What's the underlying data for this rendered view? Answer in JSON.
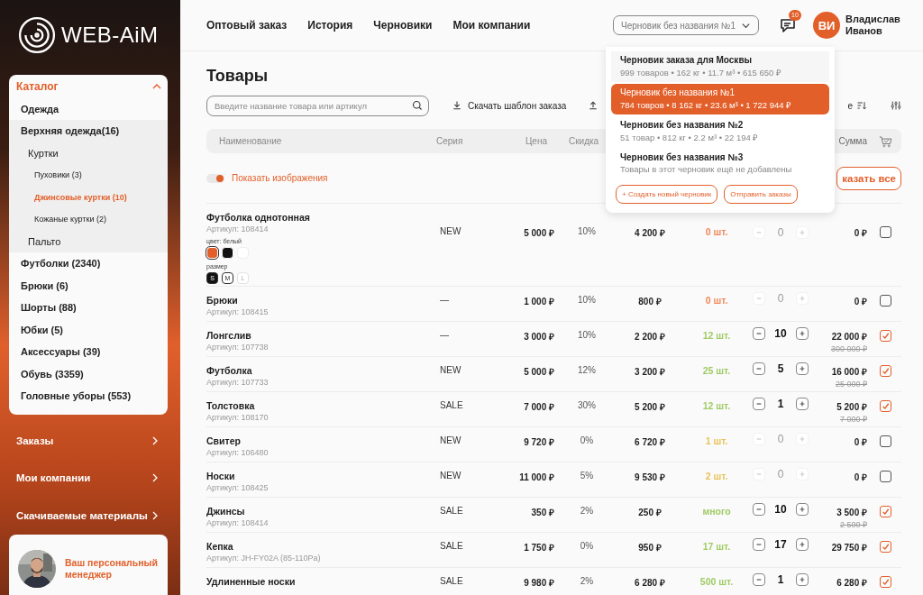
{
  "brand": {
    "name": "WEB-AiM"
  },
  "catalog": {
    "title": "Каталог",
    "expanded": true,
    "items": [
      {
        "label": "Одежда",
        "selected": false
      },
      {
        "label": "Верхняя одежда(16)",
        "selected": false,
        "expanded": true,
        "children": [
          {
            "label": "Куртки",
            "selected": false,
            "expanded": true,
            "children": [
              {
                "label": "Пуховики (3)",
                "selected": false
              },
              {
                "label": "Джинсовые куртки (10)",
                "selected": true
              },
              {
                "label": "Кожаные куртки (2)",
                "selected": false
              }
            ]
          },
          {
            "label": "Пальто",
            "selected": false
          }
        ]
      },
      {
        "label": "Футболки (2340)",
        "selected": false
      },
      {
        "label": "Брюки (6)",
        "selected": false
      },
      {
        "label": "Шорты (88)",
        "selected": false
      },
      {
        "label": "Юбки (5)",
        "selected": false
      },
      {
        "label": "Аксессуары (39)",
        "selected": false
      },
      {
        "label": "Обувь (3359)",
        "selected": false
      },
      {
        "label": "Головные уборы (553)",
        "selected": false
      }
    ]
  },
  "sidebar_nav": [
    "Заказы",
    "Мои компании",
    "Скачиваемые материалы"
  ],
  "manager": {
    "label": "Ваш персональный менеджер"
  },
  "top_nav": [
    "Оптовый заказ",
    "История",
    "Черновики",
    "Мои компании"
  ],
  "draft_select": {
    "value": "Черновик без названия №1"
  },
  "chat": {
    "badge": "10"
  },
  "user": {
    "initials": "ВИ",
    "name": "Владислав Иванов"
  },
  "page_title": "Товары",
  "search": {
    "placeholder": "Введите название товара или артикул"
  },
  "download_link": "Скачать шаблон заказа",
  "sort_label": "е",
  "table": {
    "columns": [
      "Наименование",
      "Серия",
      "Цена",
      "Скидка",
      "Сумма"
    ],
    "show_images": {
      "label": "Показать изображения",
      "on": true
    },
    "order_all_button": "казать все",
    "rows": [
      {
        "name": "Футболка однотонная",
        "article": "Артикул: 108414",
        "series": "NEW",
        "price": "5 000 ₽",
        "discount": "10%",
        "discounted": "4 200 ₽",
        "stock": "0 шт.",
        "color": "#f0885a",
        "qty": "0",
        "sum": "0 ₽",
        "checked": false,
        "variants": {
          "color_label": "цвет: белый",
          "colors": [
            {
              "color": "#e35f2a",
              "selected": true
            },
            {
              "color": "#111111",
              "selected": false
            },
            {
              "color": "#ffffff",
              "selected": false
            }
          ],
          "size_label": "размер",
          "sizes": [
            {
              "label": "S",
              "selected": true,
              "disabled": false
            },
            {
              "label": "M",
              "selected": false,
              "disabled": false
            },
            {
              "label": "L",
              "selected": false,
              "disabled": true
            }
          ]
        }
      },
      {
        "name": "Брюки",
        "article": "Артикул: 108415",
        "series": "—",
        "price": "1 000 ₽",
        "discount": "10%",
        "discounted": "800 ₽",
        "stock": "0 шт.",
        "color": "#f0885a",
        "qty": "0",
        "sum": "0 ₽",
        "checked": false
      },
      {
        "name": "Лонгслив",
        "article": "Артикул: 107738",
        "series": "—",
        "price": "3 000 ₽",
        "discount": "10%",
        "discounted": "2 200 ₽",
        "stock": "12 шт.",
        "color": "#9fcb63",
        "qty": "10",
        "sum": "22 000 ₽",
        "old_sum": "300 000 ₽",
        "checked": true
      },
      {
        "name": "Футболка",
        "article": "Артикул: 107733",
        "series": "NEW",
        "price": "5 000 ₽",
        "discount": "12%",
        "discounted": "3 200 ₽",
        "stock": "25 шт.",
        "color": "#9fcb63",
        "qty": "5",
        "sum": "16 000 ₽",
        "old_sum": "25 000 ₽",
        "checked": true
      },
      {
        "name": "Толстовка",
        "article": "Артикул: 108170",
        "series": "SALE",
        "price": "7 000 ₽",
        "discount": "30%",
        "discounted": "5 200 ₽",
        "stock": "12 шт.",
        "color": "#9fcb63",
        "qty": "1",
        "sum": "5 200 ₽",
        "old_sum": "7 000 ₽",
        "checked": true
      },
      {
        "name": "Свитер",
        "article": "Артикул: 106480",
        "series": "NEW",
        "price": "9 720 ₽",
        "discount": "0%",
        "discounted": "6 720 ₽",
        "stock": "1 шт.",
        "color": "#e8c35a",
        "qty": "0",
        "sum": "0 ₽",
        "checked": false
      },
      {
        "name": "Носки",
        "article": "Артикул: 108425",
        "series": "NEW",
        "price": "11 000 ₽",
        "discount": "5%",
        "discounted": "9 530 ₽",
        "stock": "2 шт.",
        "color": "#e8c35a",
        "qty": "0",
        "sum": "0 ₽",
        "checked": false
      },
      {
        "name": "Джинсы",
        "article": "Артикул: 108414",
        "series": "SALE",
        "price": "350 ₽",
        "discount": "2%",
        "discounted": "250 ₽",
        "stock": "много",
        "color": "#9fcb63",
        "qty": "10",
        "sum": "3 500 ₽",
        "old_sum": "2 500 ₽",
        "checked": true
      },
      {
        "name": "Кепка",
        "article": "Артикул: JH-FY02A (85-110Pa)",
        "series": "SALE",
        "price": "1 750 ₽",
        "discount": "0%",
        "discounted": "950 ₽",
        "stock": "17 шт.",
        "color": "#9fcb63",
        "qty": "17",
        "sum": "29 750 ₽",
        "checked": true
      },
      {
        "name": "Удлиненные носки",
        "series": "SALE",
        "price": "9 980 ₽",
        "discount": "2%",
        "discounted": "6 280 ₽",
        "stock": "500 шт.",
        "color": "#9fcb63",
        "qty": "1",
        "sum": "6 280 ₽",
        "checked": true
      }
    ]
  },
  "drafts_menu": {
    "items": [
      {
        "title": "Черновик заказа для Москвы",
        "summary": "999 товаров • 162 кг • 11.7 м³ • 615 650 ₽",
        "selected": false
      },
      {
        "title": "Черновик без названия №1",
        "summary": "784 товров • 8 162 кг • 23.6 м³ • 1 722 944 ₽",
        "selected": true
      },
      {
        "title": "Черновик без названия №2",
        "summary": "51 товар • 812 кг • 2.2 м³ • 22 194 ₽",
        "selected": false
      },
      {
        "title": "Черновик без названия №3",
        "summary": "Товары в этот черновик ещё не добавлены",
        "selected": false
      }
    ],
    "buttons": [
      "+ Создать новый черновик",
      "Отправить заказы"
    ]
  }
}
